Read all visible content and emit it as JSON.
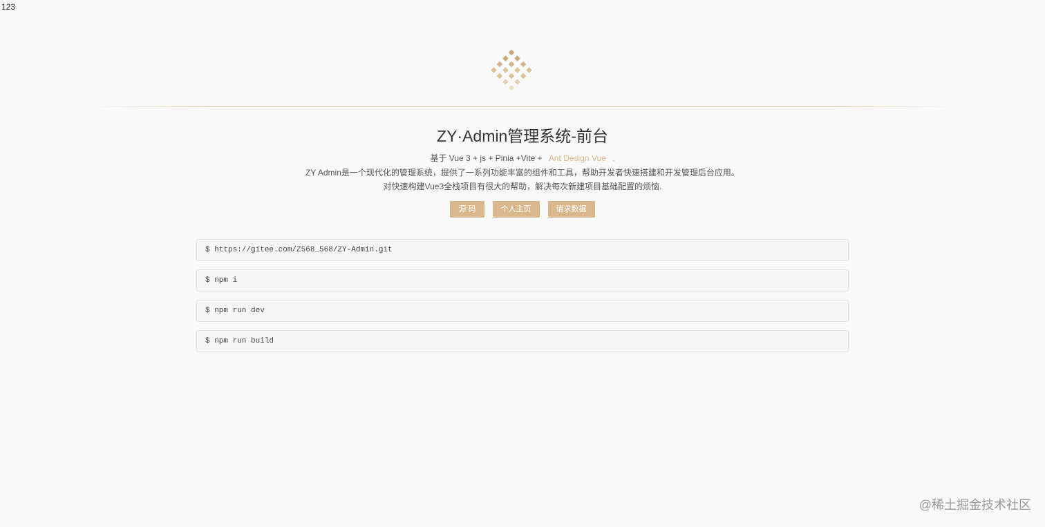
{
  "corner_text": "123",
  "header": {
    "title": "ZY·Admin管理系统-前台",
    "stack_prefix": "基于 Vue 3 + js + Pinia +Vite +",
    "stack_link": "Ant Design Vue",
    "stack_suffix": ".",
    "desc_line2": "ZY Admin是一个现代化的管理系统，提供了一系列功能丰富的组件和工具，帮助开发者快速搭建和开发管理后台应用。",
    "desc_line3": "对快速构建Vue3全栈项目有很大的帮助，解决每次新建项目基础配置的烦恼."
  },
  "buttons": {
    "source": "源 码",
    "homepage": "个人主页",
    "request": "请求数据"
  },
  "commands": [
    "$ https://gitee.com/Z568_568/ZY-Admin.git",
    "$ npm i",
    "$ npm run dev",
    "$ npm run build"
  ],
  "watermark": "@稀土掘金技术社区",
  "colors": {
    "accent": "#d8b88c",
    "background": "#f9f9f9"
  },
  "icons": {
    "logo": "diamond-grid-logo-icon"
  }
}
